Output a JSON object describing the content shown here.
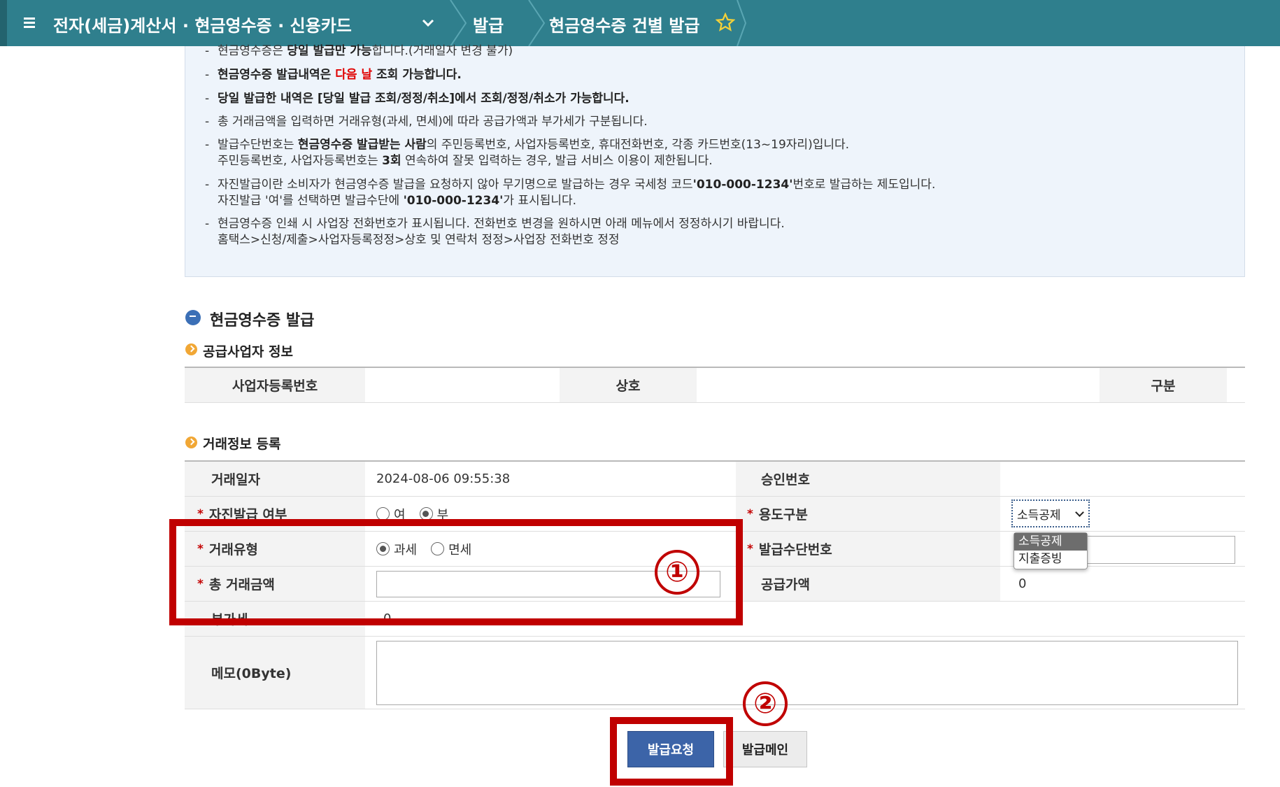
{
  "header": {
    "title": "전자(세금)계산서 · 현금영수증 · 신용카드",
    "crumb_issue": "발급",
    "crumb_current": "현금영수증 건별 발급",
    "accent_color": "#2f7f8d"
  },
  "notice": {
    "line1_b": "당일 발급만 가능",
    "line1_pre": "현금영수증은 ",
    "line1_post": "합니다.(거래일자 변경 불가)",
    "line2_pre": "현금영수증 발급내역은 ",
    "line2_red": "다음 날",
    "line2_post": " 조회 가능합니다.",
    "line3": "당일 발급한 내역은 [당일 발급 조회/정정/취소]에서 조회/정정/취소가 가능합니다.",
    "line4": "총 거래금액을 입력하면 거래유형(과세, 면세)에 따라 공급가액과 부가세가 구분됩니다.",
    "line5_pre": "발급수단번호는 ",
    "line5_b": "현금영수증 발급받는 사람",
    "line5_post": "의  주민등록번호, 사업자등록번호, 휴대전화번호, 각종 카드번호(13~19자리)입니다.",
    "line6_pre": "주민등록번호, 사업자등록번호는 ",
    "line6_b": "3회",
    "line6_post": " 연속하여 잘못 입력하는 경우, 발급 서비스 이용이 제한됩니다.",
    "line7_pre": "자진발급이란 소비자가 현금영수증 발급을 요청하지 않아 무기명으로 발급하는 경우 국세청 코드",
    "line7_b": "'010-000-1234'",
    "line7_post": "번호로 발급하는 제도입니다.",
    "line8_pre": "자진발급 '여'를 선택하면 발급수단에 ",
    "line8_b": "'010-000-1234'",
    "line8_post": "가 표시됩니다.",
    "line9": "현금영수증 인쇄 시 사업장 전화번호가 표시됩니다. 전화번호 변경을 원하시면 아래 메뉴에서 정정하시기 바랍니다.",
    "line10": "홈택스>신청/제출>사업자등록정정>상호 및 연락처 정정>사업장 전화번호 정정",
    "dash": "-"
  },
  "issue_section": {
    "title": "현금영수증 발급",
    "supplier_title": "공급사업자 정보",
    "supplier": {
      "biz_no_label": "사업자등록번호",
      "biz_no_value": "",
      "name_label": "상호",
      "name_value": "",
      "type_label": "구분",
      "type_value": ""
    },
    "trade_title": "거래정보 등록"
  },
  "trade": {
    "date_label": "거래일자",
    "date_value": "2024-08-06 09:55:38",
    "approval_label": "승인번호",
    "approval_value": "",
    "self_issue_label": "자진발급 여부",
    "self_issue_yes": "여",
    "self_issue_no": "부",
    "self_issue_selected": "부",
    "usage_label": "용도구분",
    "usage_selected": "소득공제",
    "usage_options": [
      "소득공제",
      "지출증빙"
    ],
    "trade_type_label": "거래유형",
    "trade_type_taxable": "과세",
    "trade_type_exempt": "면세",
    "trade_type_selected": "과세",
    "means_label": "발급수단번호",
    "means_value": "",
    "total_label": "총 거래금액",
    "total_value": "",
    "supply_label": "공급가액",
    "supply_value": "0",
    "vat_label": "부가세",
    "vat_value": "0",
    "memo_label": "메모(0Byte)",
    "memo_value": "",
    "required_mark": "*"
  },
  "buttons": {
    "request": "발급요청",
    "main": "발급메인"
  },
  "annotations": {
    "one": "①",
    "two": "②",
    "color": "#c00000"
  }
}
